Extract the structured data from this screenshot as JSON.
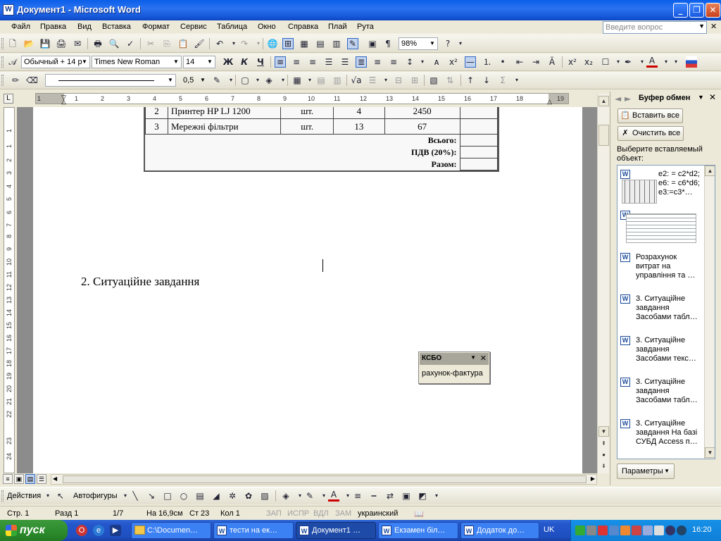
{
  "window": {
    "app_title": "Документ1 - Microsoft Word",
    "icon_letter": "W",
    "controls": {
      "minimize": "_",
      "maximize": "❐",
      "close": "✕"
    }
  },
  "menu": {
    "items": [
      "Файл",
      "Правка",
      "Вид",
      "Вставка",
      "Формат",
      "Сервис",
      "Таблица",
      "Окно",
      "Справка",
      "Плай",
      "Рута"
    ],
    "ask_placeholder": "Введите вопрос",
    "close_doc": "✕"
  },
  "standard_toolbar": {
    "zoom": "98%"
  },
  "formatting_toolbar": {
    "style": "Обычный + 14 р",
    "font": "Times New Roman",
    "size": "14",
    "bold": "Ж",
    "italic": "К",
    "underline": "Ч"
  },
  "tables_toolbar": {
    "line_width": "0,5"
  },
  "ruler": {
    "corner": "L",
    "h_numbers": [
      "1",
      "1",
      "2",
      "3",
      "4",
      "5",
      "6",
      "7",
      "8",
      "9",
      "10",
      "11",
      "12",
      "13",
      "14",
      "15",
      "16",
      "17",
      "18",
      "19"
    ],
    "v_numbers": [
      "1",
      "1",
      "2",
      "3",
      "4",
      "5",
      "6",
      "7",
      "8",
      "9",
      "10",
      "11",
      "12",
      "13",
      "14",
      "15",
      "16",
      "17",
      "18",
      "19",
      "20",
      "21",
      "22",
      "23",
      "24"
    ]
  },
  "document": {
    "scan_table": {
      "rows": [
        [
          "2",
          "Принтер HP LJ 1200",
          "шт.",
          "4",
          "2450",
          ""
        ],
        [
          "3",
          "Мережні фільтри",
          "шт.",
          "13",
          "67",
          ""
        ]
      ],
      "totals": [
        "Всього:",
        "ПДВ (20%):",
        "Разом:"
      ]
    },
    "heading": "2. Ситуаційне завдання"
  },
  "ksbo": {
    "title": "КСБО",
    "item": "рахунок-фактура"
  },
  "task_pane": {
    "title": "Буфер обмен",
    "paste_all": "Вставить все",
    "clear_all": "Очистить все",
    "choose_label": "Выберите вставляемый объект:",
    "clips": [
      {
        "kind": "image",
        "text": "e2: = c2*d2; e6: = c6*d6; e3:=c3*…"
      },
      {
        "kind": "image2",
        "text": ""
      },
      {
        "kind": "text",
        "text": "Розрахунок витрат на управління та …"
      },
      {
        "kind": "text",
        "text": "3. Ситуаційне завдання Засобами табл…"
      },
      {
        "kind": "text",
        "text": "3. Ситуаційне завдання Засобами текс…"
      },
      {
        "kind": "text",
        "text": "3. Ситуаційне завдання Засобами табл…"
      },
      {
        "kind": "text",
        "text": "3. Ситуаційне завдання На базі СУБД Access п…"
      }
    ],
    "params": "Параметры"
  },
  "drawing_toolbar": {
    "actions": "Действия",
    "autoshapes": "Автофигуры"
  },
  "status": {
    "page": "Стр. 1",
    "section": "Разд 1",
    "pages": "1/7",
    "at": "На 16,9см",
    "line": "Ст 23",
    "col": "Кол 1",
    "rec": "ЗАП",
    "trk": "ИСПР",
    "ext": "ВДЛ",
    "ovr": "ЗАМ",
    "lang": "украинский"
  },
  "taskbar": {
    "start": "пуск",
    "tasks": [
      {
        "label": "C:\\Documen…",
        "type": "folder",
        "active": false
      },
      {
        "label": "тести на ек…",
        "type": "word",
        "active": false
      },
      {
        "label": "Документ1 …",
        "type": "word",
        "active": true
      },
      {
        "label": "Екзамен біл…",
        "type": "word",
        "active": false
      },
      {
        "label": "Додаток до…",
        "type": "word",
        "active": false
      }
    ],
    "lang": "UK",
    "clock": "16:20"
  },
  "colors": {
    "titlebar": "#0a5ee9",
    "taskbar": "#245edb",
    "start_green": "#2b8a2b",
    "chrome": "#ece9d8"
  }
}
